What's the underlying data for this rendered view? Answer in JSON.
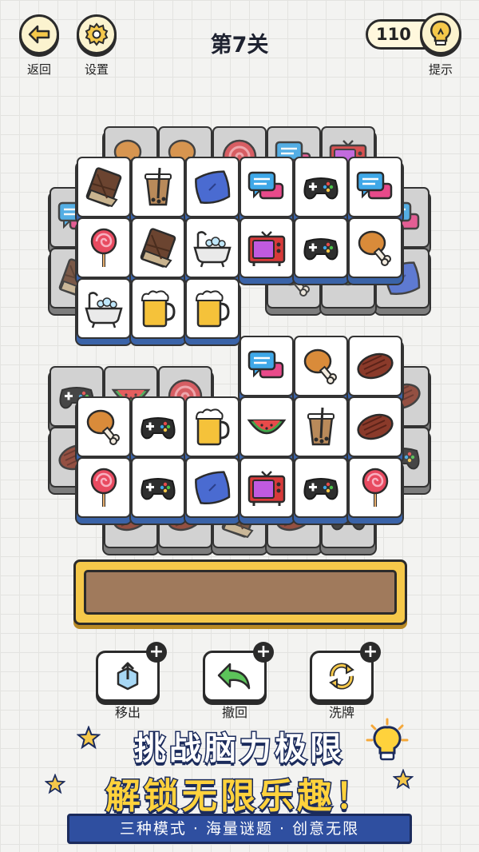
{
  "top": {
    "back_label": "返回",
    "settings_label": "设置",
    "level_title": "第7关",
    "hint_count": "110",
    "hint_label": "提示"
  },
  "tools": {
    "remove_label": "移出",
    "undo_label": "撤回",
    "shuffle_label": "洗牌"
  },
  "promo": {
    "line1": "挑战脑力极限",
    "line2": "解锁无限乐趣！",
    "banner": "三种模式 · 海量谜题 · 创意无限"
  },
  "colors": {
    "tile_face": "#ffffff",
    "tile_edge": "#3a63a8",
    "tile_back": "#d2d2d2",
    "tray_frame": "#f5c84a",
    "tray_inner": "#a07a5c",
    "promo_yellow": "#ffd23c",
    "promo_banner": "#2f4fa0"
  },
  "board": {
    "upper_back_row": [
      "drumstick",
      "drumstick",
      "lollipop-swirl",
      "chat",
      "tv"
    ],
    "upper_row1": [
      "chocolate",
      "bubble-tea",
      "pillow",
      "chat",
      "gamepad",
      "chat"
    ],
    "upper_row2": [
      "lollipop",
      "chocolate",
      "bathtub",
      "tv",
      "gamepad",
      "drumstick"
    ],
    "upper_row3": [
      "bathtub",
      "beer",
      "beer"
    ],
    "lower_row0": [
      "chat",
      "drumstick",
      "steak"
    ],
    "lower_row1": [
      "drumstick",
      "gamepad",
      "beer",
      "watermelon",
      "bubble-tea",
      "steak"
    ],
    "lower_row2": [
      "lollipop",
      "gamepad",
      "pillow",
      "tv",
      "gamepad",
      "lollipop"
    ]
  }
}
